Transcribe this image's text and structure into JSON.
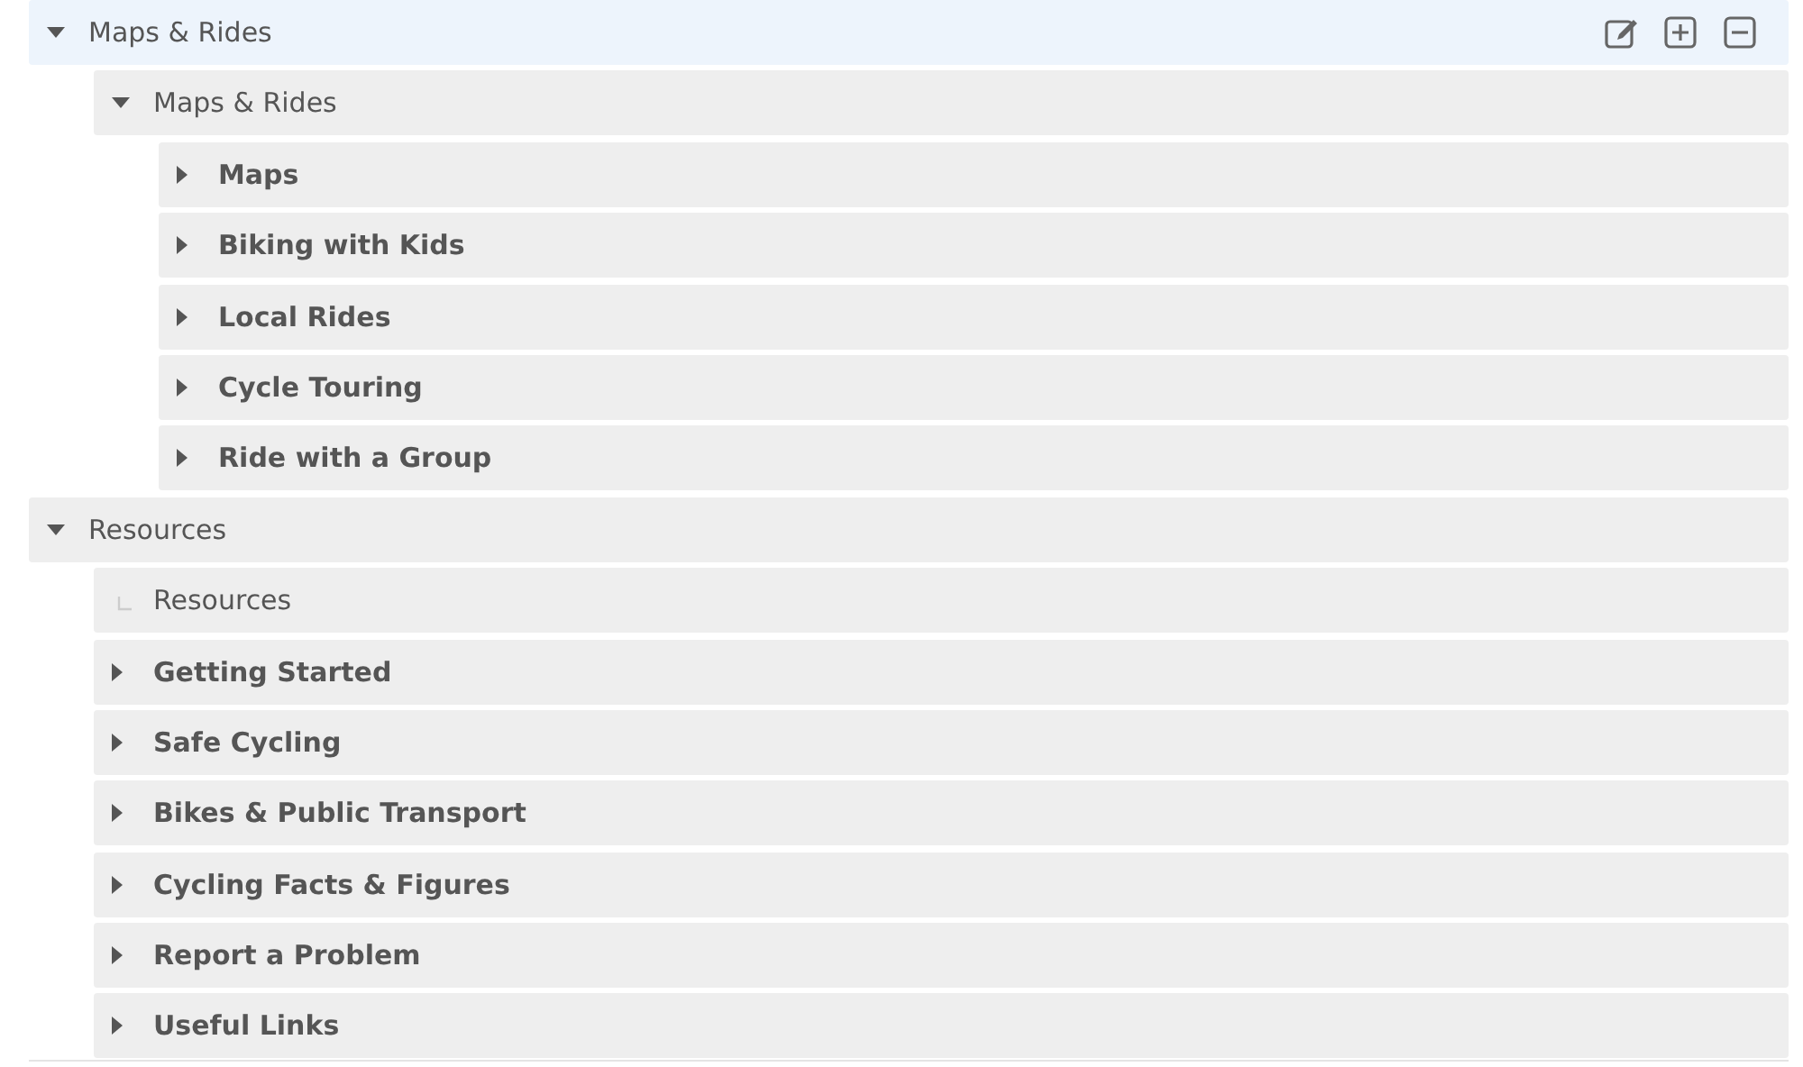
{
  "tree": [
    {
      "label": "Maps & Rides",
      "kind": "section",
      "expanded": true,
      "selected": true,
      "children": [
        {
          "label": "Maps & Rides",
          "kind": "section",
          "expanded": true,
          "selected": false,
          "children": [
            {
              "label": "Maps",
              "kind": "page",
              "expanded": false,
              "selected": false
            },
            {
              "label": "Biking with Kids",
              "kind": "page",
              "expanded": false,
              "selected": false
            },
            {
              "label": "Local Rides",
              "kind": "page",
              "expanded": false,
              "selected": false
            },
            {
              "label": "Cycle Touring",
              "kind": "page",
              "expanded": false,
              "selected": false
            },
            {
              "label": "Ride with a Group",
              "kind": "page",
              "expanded": false,
              "selected": false
            }
          ]
        }
      ]
    },
    {
      "label": "Resources",
      "kind": "section",
      "expanded": true,
      "selected": false,
      "children": [
        {
          "label": "Resources",
          "kind": "leaf",
          "selected": false
        },
        {
          "label": "Getting Started",
          "kind": "page",
          "expanded": false,
          "selected": false
        },
        {
          "label": "Safe Cycling",
          "kind": "page",
          "expanded": false,
          "selected": false
        },
        {
          "label": "Bikes & Public Transport",
          "kind": "page",
          "expanded": false,
          "selected": false
        },
        {
          "label": "Cycling Facts & Figures",
          "kind": "page",
          "expanded": false,
          "selected": false
        },
        {
          "label": "Report a Problem",
          "kind": "page",
          "expanded": false,
          "selected": false
        },
        {
          "label": "Useful Links",
          "kind": "page",
          "expanded": false,
          "selected": false
        }
      ]
    }
  ]
}
